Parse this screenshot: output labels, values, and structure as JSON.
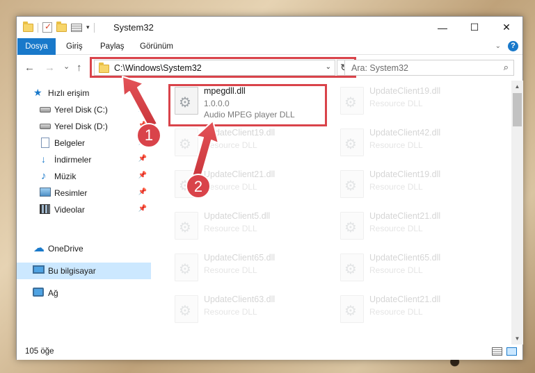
{
  "window": {
    "title": "System32"
  },
  "ribbon": {
    "tabs": [
      "Dosya",
      "Giriş",
      "Paylaş",
      "Görünüm"
    ],
    "help": "?"
  },
  "toolbar": {
    "back": "←",
    "forward": "→",
    "recent": "⌄",
    "up": "↑",
    "refresh": "↻"
  },
  "address": {
    "path": "C:\\Windows\\System32"
  },
  "search": {
    "placeholder": "Ara: System32"
  },
  "sidebar": {
    "items": [
      {
        "label": "Hızlı erişim"
      },
      {
        "label": "Yerel Disk (C:)"
      },
      {
        "label": "Yerel Disk (D:)"
      },
      {
        "label": "Belgeler"
      },
      {
        "label": "İndirmeler"
      },
      {
        "label": "Müzik"
      },
      {
        "label": "Resimler"
      },
      {
        "label": "Videolar"
      },
      {
        "label": "OneDrive"
      },
      {
        "label": "Bu bilgisayar"
      },
      {
        "label": "Ağ"
      }
    ]
  },
  "files": [
    {
      "name": "mpegdll.dll",
      "version": "1.0.0.0",
      "desc": "Audio MPEG player DLL"
    },
    {
      "name": "UpdateClient19.dll",
      "desc": "Resource DLL"
    },
    {
      "name": "UpdateClient42.dll",
      "desc": "Resource DLL"
    },
    {
      "name": "UpdateClient19.dll",
      "desc": "Resource DLL"
    },
    {
      "name": "UpdateClient21.dll",
      "desc": "Resource DLL"
    },
    {
      "name": "UpdateClient19.dll",
      "desc": "Resource DLL"
    },
    {
      "name": "UpdateClient5.dll",
      "desc": "Resource DLL"
    },
    {
      "name": "UpdateClient21.dll",
      "desc": "Resource DLL"
    },
    {
      "name": "UpdateClient65.dll",
      "desc": "Resource DLL"
    },
    {
      "name": "UpdateClient65.dll",
      "desc": "Resource DLL"
    },
    {
      "name": "UpdateClient63.dll",
      "desc": "Resource DLL"
    },
    {
      "name": "UpdateClient21.dll",
      "desc": "Resource DLL"
    }
  ],
  "status": {
    "count": "105 öğe"
  },
  "annotations": {
    "step1": "1",
    "step2": "2",
    "color": "#d9434a"
  }
}
